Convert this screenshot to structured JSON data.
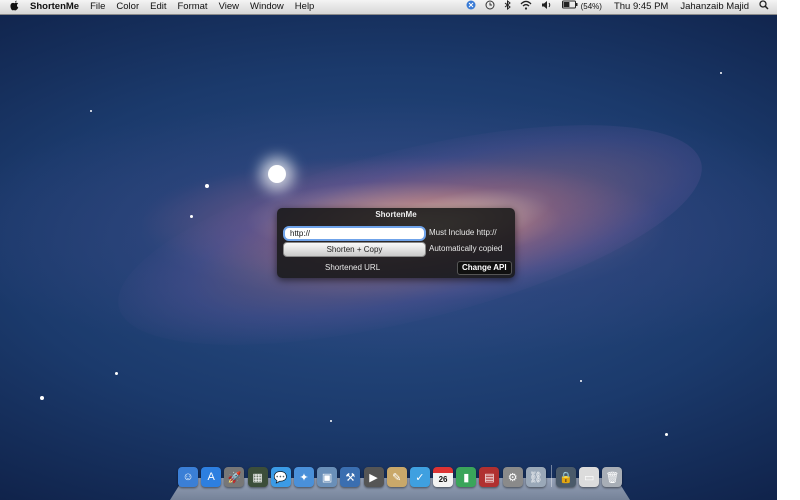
{
  "menubar": {
    "apple_icon": "apple-icon",
    "app_name": "ShortenMe",
    "menus": [
      "File",
      "Color",
      "Edit",
      "Format",
      "View",
      "Window",
      "Help"
    ],
    "status_icons": [
      "bluetooth-like-icon",
      "time-machine-icon",
      "bluetooth-icon",
      "wifi-icon",
      "volume-icon",
      "battery-icon"
    ],
    "battery_text": "(54%)",
    "battery_level": 0.54,
    "clock": "Thu 9:45 PM",
    "user": "Jahanzaib Majid",
    "search_icon": "spotlight-icon"
  },
  "panel": {
    "title": "ShortenMe",
    "url_value": "http://",
    "hint": "Must Include http://",
    "shorten_label": "Shorten + Copy",
    "copied_note": "Automatically copied",
    "shortened_label": "Shortened URL",
    "change_api_label": "Change API"
  },
  "dock": {
    "calendar_day": "26",
    "apps": [
      {
        "name": "finder-icon",
        "color": "#3b7fd6",
        "glyph": "☺"
      },
      {
        "name": "app-store-icon",
        "color": "#2d7fe0",
        "glyph": "A"
      },
      {
        "name": "launchpad-icon",
        "color": "#777777",
        "glyph": "🚀"
      },
      {
        "name": "mission-control-icon",
        "color": "#3c4e3a",
        "glyph": "▦"
      },
      {
        "name": "messages-icon",
        "color": "#3b9be6",
        "glyph": "💬"
      },
      {
        "name": "safari-icon",
        "color": "#4a90d9",
        "glyph": "✦"
      },
      {
        "name": "preview-icon",
        "color": "#6a8fb8",
        "glyph": "▣"
      },
      {
        "name": "xcode-icon",
        "color": "#3a6eb0",
        "glyph": "⚒"
      },
      {
        "name": "facetime-icon",
        "color": "#555555",
        "glyph": "▶"
      },
      {
        "name": "notes-icon",
        "color": "#c9a86a",
        "glyph": "✎"
      },
      {
        "name": "twitter-icon",
        "color": "#3fa0e0",
        "glyph": "✓"
      },
      {
        "name": "calendar-icon",
        "color": "#f2f2f2",
        "glyph": ""
      },
      {
        "name": "numbers-icon",
        "color": "#3aa55a",
        "glyph": "▮"
      },
      {
        "name": "photo-booth-icon",
        "color": "#b03030",
        "glyph": "▤"
      },
      {
        "name": "system-preferences-icon",
        "color": "#8a8a8a",
        "glyph": "⚙"
      },
      {
        "name": "links-icon",
        "color": "#9aa8b8",
        "glyph": "⛓"
      }
    ],
    "right_items": [
      {
        "name": "security-lock-icon",
        "color": "#4a5a6a",
        "glyph": "🔒"
      },
      {
        "name": "document-icon",
        "color": "#dcdcdc",
        "glyph": "▭"
      },
      {
        "name": "trash-icon",
        "color": "#a8aeb6",
        "glyph": "🗑"
      }
    ]
  }
}
